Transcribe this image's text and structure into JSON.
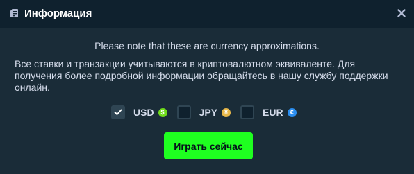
{
  "header": {
    "title": "Информация",
    "icon": "receipt-icon",
    "close_icon": "close-icon"
  },
  "note": "Please note that these are currency approximations.",
  "description": "Все ставки и транзакции учитываются в криптовалютном эквиваленте. Для получения более подробной информации обращайтесь в нашу службу поддержки онлайн.",
  "currencies": [
    {
      "code": "USD",
      "checked": true,
      "symbol": "$",
      "color": "#6fdc1a"
    },
    {
      "code": "JPY",
      "checked": false,
      "symbol": "¥",
      "color": "#e8b84a"
    },
    {
      "code": "EUR",
      "checked": false,
      "symbol": "€",
      "color": "#2b8ef0"
    }
  ],
  "play_button": "Играть сейчас",
  "colors": {
    "background": "#1a2c38",
    "header": "#0f212e",
    "accent": "#1fff20"
  }
}
